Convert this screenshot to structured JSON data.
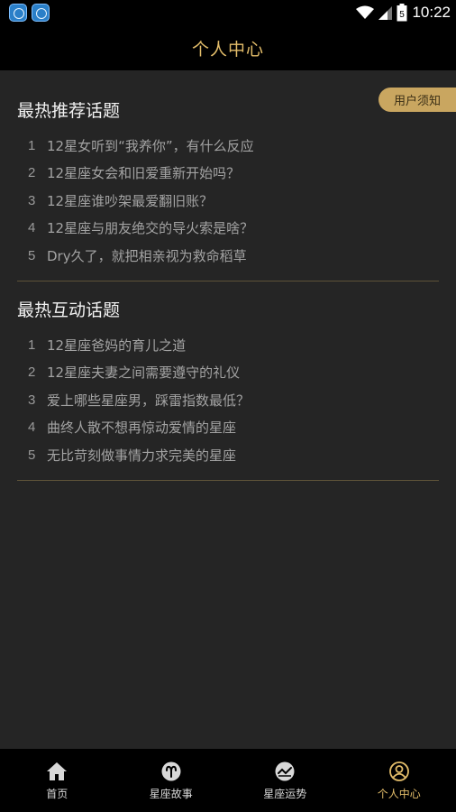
{
  "status_bar": {
    "time": "10:22",
    "battery_level": "5"
  },
  "header": {
    "title": "个人中心"
  },
  "notice_button": {
    "label": "用户须知"
  },
  "hot_recommended": {
    "title": "最热推荐话题",
    "items": [
      {
        "num": "1",
        "text": "12星女听到“我养你”，有什么反应"
      },
      {
        "num": "2",
        "text": "12星座女会和旧爱重新开始吗？"
      },
      {
        "num": "3",
        "text": "12星座谁吵架最爱翻旧账？"
      },
      {
        "num": "4",
        "text": "12星座与朋友绝交的导火索是啥？"
      },
      {
        "num": "5",
        "text": "Dry久了，就把相亲视为救命稻草"
      }
    ]
  },
  "hot_interactive": {
    "title": "最热互动话题",
    "items": [
      {
        "num": "1",
        "text": "12星座爸妈的育儿之道"
      },
      {
        "num": "2",
        "text": "12星座夫妻之间需要遵守的礼仪"
      },
      {
        "num": "3",
        "text": "爱上哪些星座男，踩雷指数最低？"
      },
      {
        "num": "4",
        "text": "曲终人散不想再惊动爱情的星座"
      },
      {
        "num": "5",
        "text": "无比苛刻做事情力求完美的星座"
      }
    ]
  },
  "tab_bar": {
    "tabs": [
      {
        "label": "首页",
        "icon": "home-icon"
      },
      {
        "label": "星座故事",
        "icon": "aries-icon"
      },
      {
        "label": "星座运势",
        "icon": "trend-icon"
      },
      {
        "label": "个人中心",
        "icon": "user-icon"
      }
    ],
    "active_index": 3
  },
  "colors": {
    "accent": "#e3bd6a",
    "background": "#252525",
    "bar": "#000000",
    "pill": "#c9a660"
  }
}
